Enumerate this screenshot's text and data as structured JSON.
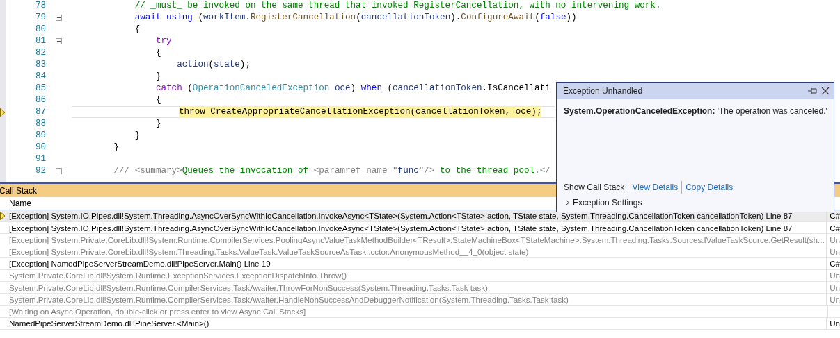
{
  "editor": {
    "lines": [
      {
        "number": "78",
        "fold": false,
        "current": false,
        "tokens": [
          {
            "kind": "comment",
            "text": "            // _must_ be invoked on the same thread that invoked RegisterCancellation, with no intervening work."
          }
        ]
      },
      {
        "number": "79",
        "fold": true,
        "current": false,
        "tokens": [
          {
            "kind": "keyword",
            "text": "            await"
          },
          {
            "kind": "keyword",
            "text": " using"
          },
          {
            "kind": "plain",
            "text": " ("
          },
          {
            "kind": "local",
            "text": "workItem"
          },
          {
            "kind": "plain",
            "text": "."
          },
          {
            "kind": "method",
            "text": "RegisterCancellation"
          },
          {
            "kind": "plain",
            "text": "("
          },
          {
            "kind": "local",
            "text": "cancellationToken"
          },
          {
            "kind": "plain",
            "text": ")."
          },
          {
            "kind": "method",
            "text": "ConfigureAwait"
          },
          {
            "kind": "plain",
            "text": "("
          },
          {
            "kind": "keyword",
            "text": "false"
          },
          {
            "kind": "plain",
            "text": "))"
          }
        ]
      },
      {
        "number": "80",
        "fold": false,
        "current": false,
        "tokens": [
          {
            "kind": "plain",
            "text": "            {"
          }
        ]
      },
      {
        "number": "81",
        "fold": true,
        "current": false,
        "tokens": [
          {
            "kind": "control",
            "text": "                try"
          }
        ]
      },
      {
        "number": "82",
        "fold": false,
        "current": false,
        "tokens": [
          {
            "kind": "plain",
            "text": "                {"
          }
        ]
      },
      {
        "number": "83",
        "fold": false,
        "current": false,
        "tokens": [
          {
            "kind": "local",
            "text": "                    action"
          },
          {
            "kind": "plain",
            "text": "("
          },
          {
            "kind": "local",
            "text": "state"
          },
          {
            "kind": "plain",
            "text": ");"
          }
        ]
      },
      {
        "number": "84",
        "fold": false,
        "current": false,
        "tokens": [
          {
            "kind": "plain",
            "text": "                }"
          }
        ]
      },
      {
        "number": "85",
        "fold": false,
        "current": false,
        "tokens": [
          {
            "kind": "control",
            "text": "                catch"
          },
          {
            "kind": "plain",
            "text": " ("
          },
          {
            "kind": "type",
            "text": "OperationCanceledException"
          },
          {
            "kind": "local",
            "text": " oce"
          },
          {
            "kind": "plain",
            "text": ") "
          },
          {
            "kind": "keyword",
            "text": "when"
          },
          {
            "kind": "plain",
            "text": " ("
          },
          {
            "kind": "local",
            "text": "cancellationToken"
          },
          {
            "kind": "plain",
            "text": ".IsCancellati"
          }
        ]
      },
      {
        "number": "86",
        "fold": false,
        "current": false,
        "tokens": [
          {
            "kind": "plain",
            "text": "                {"
          }
        ]
      },
      {
        "number": "87",
        "fold": false,
        "current": true,
        "tokens": [
          {
            "kind": "highlight",
            "text": "throw CreateAppropriateCancellationException(cancellationToken, oce);"
          }
        ]
      },
      {
        "number": "88",
        "fold": false,
        "current": false,
        "tokens": [
          {
            "kind": "plain",
            "text": "                }"
          }
        ]
      },
      {
        "number": "89",
        "fold": false,
        "current": false,
        "tokens": [
          {
            "kind": "plain",
            "text": "            }"
          }
        ]
      },
      {
        "number": "90",
        "fold": false,
        "current": false,
        "tokens": [
          {
            "kind": "plain",
            "text": "        }"
          }
        ]
      },
      {
        "number": "91",
        "fold": false,
        "current": false
      },
      {
        "number": "92",
        "fold": true,
        "current": false,
        "tokens": [
          {
            "kind": "doc",
            "text": "        /// <summary>"
          },
          {
            "kind": "comment",
            "text": "Queues the invocation of "
          },
          {
            "kind": "doc",
            "text": "<paramref name=\""
          },
          {
            "kind": "local",
            "text": "func"
          },
          {
            "kind": "doc",
            "text": "\"/>"
          },
          {
            "kind": "comment",
            "text": " to the thread pool."
          },
          {
            "kind": "doc",
            "text": "</"
          }
        ]
      }
    ]
  },
  "exception_popup": {
    "title": "Exception Unhandled",
    "exception_type": "System.OperationCanceledException:",
    "message": "'The operation was canceled.'",
    "show_call_stack": "Show Call Stack",
    "links": [
      "View Details",
      "Copy Details"
    ],
    "settings": "Exception Settings"
  },
  "call_stack": {
    "title": "Call Stack",
    "columns": [
      "Name"
    ],
    "rows": [
      {
        "name": "[Exception] System.IO.Pipes.dll!System.Threading.AsyncOverSyncWithIoCancellation.InvokeAsync<TState>(System.Action<TState> action, TState state, System.Threading.CancellationToken cancellationToken) Line 87",
        "language": "C#",
        "dim": false,
        "selected": true
      },
      {
        "name": "[Exception] System.IO.Pipes.dll!System.Threading.AsyncOverSyncWithIoCancellation.InvokeAsync<TState>(System.Action<TState> action, TState state, System.Threading.CancellationToken cancellationToken) Line 87",
        "language": "C#",
        "dim": false,
        "selected": false
      },
      {
        "name": "[Exception] System.Private.CoreLib.dll!System.Runtime.CompilerServices.PoolingAsyncValueTaskMethodBuilder<TResult>.StateMachineBox<TStateMachine>.System.Threading.Tasks.Sources.IValueTaskSource.GetResult(sh...",
        "language": "Un",
        "dim": true,
        "selected": false
      },
      {
        "name": "[Exception] System.Private.CoreLib.dll!System.Threading.Tasks.ValueTask.ValueTaskSourceAsTask..cctor.AnonymousMethod__4_0(object state)",
        "language": "Un",
        "dim": true,
        "selected": false
      },
      {
        "name": "[Exception] NamedPipeServerStreamDemo.dll!PipeServer.Main() Line 19",
        "language": "C#",
        "dim": false,
        "selected": false
      },
      {
        "name": "System.Private.CoreLib.dll!System.Runtime.ExceptionServices.ExceptionDispatchInfo.Throw()",
        "language": "Un",
        "dim": true,
        "selected": false
      },
      {
        "name": "System.Private.CoreLib.dll!System.Runtime.CompilerServices.TaskAwaiter.ThrowForNonSuccess(System.Threading.Tasks.Task task)",
        "language": "Un",
        "dim": true,
        "selected": false
      },
      {
        "name": "System.Private.CoreLib.dll!System.Runtime.CompilerServices.TaskAwaiter.HandleNonSuccessAndDebuggerNotification(System.Threading.Tasks.Task task)",
        "language": "Un",
        "dim": true,
        "selected": false
      },
      {
        "name": "[Waiting on Async Operation, double-click or press enter to view Async Call Stacks]",
        "dim": true,
        "selected": false
      },
      {
        "name": "NamedPipeServerStreamDemo.dll!PipeServer.<Main>()",
        "language": "Un",
        "dim": false,
        "selected": false
      }
    ]
  }
}
